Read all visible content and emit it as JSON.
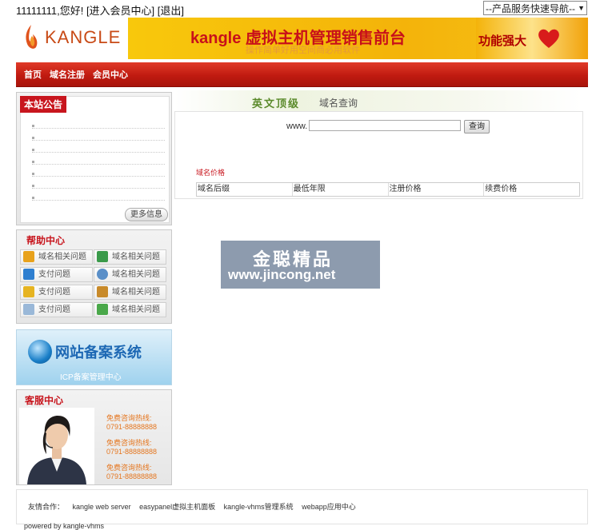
{
  "topbar": {
    "greeting": "11111111,您好!",
    "member_center": "[进入会员中心]",
    "logout": "[退出]",
    "nav_select": "--产品服务快速导航--"
  },
  "header": {
    "logo_text": "KANGLE",
    "banner_title": "kangle 虚拟主机管理销售前台",
    "banner_subtitle": "操作简单好用空间商必用软件",
    "banner_badge": "功能强大"
  },
  "nav": {
    "items": [
      "首页",
      "域名注册",
      "会员中心"
    ]
  },
  "notice": {
    "title": "本站公告",
    "more": "更多信息"
  },
  "help": {
    "title": "帮助中心",
    "items": [
      {
        "label": "域名相关问题",
        "icon": "folder-icon"
      },
      {
        "label": "域名相关问题",
        "icon": "book-icon"
      },
      {
        "label": "支付问题",
        "icon": "monitor-icon"
      },
      {
        "label": "域名相关问题",
        "icon": "eye-icon"
      },
      {
        "label": "支付问题",
        "icon": "shield-icon"
      },
      {
        "label": "域名相关问题",
        "icon": "user-icon"
      },
      {
        "label": "支付问题",
        "icon": "note-icon"
      },
      {
        "label": "域名相关问题",
        "icon": "download-icon"
      }
    ]
  },
  "beian": {
    "title": "网站备案系统",
    "subtitle": "ICP备案管理中心"
  },
  "kefu": {
    "title": "客服中心",
    "phones": [
      {
        "label": "免费咨询热线:",
        "number": "0791-88888888"
      },
      {
        "label": "免费咨询热线:",
        "number": "0791-88888888"
      },
      {
        "label": "免费咨询热线:",
        "number": "0791-88888888"
      }
    ]
  },
  "main": {
    "tab_title": "英文顶级",
    "tab_sub": "域名查询",
    "www_label": "www.",
    "domain_value": "",
    "search_button": "查询",
    "price_title": "域名价格",
    "price_columns": [
      "域名后缀",
      "最低年限",
      "注册价格",
      "续费价格"
    ]
  },
  "watermark": {
    "line1": "金聪精品",
    "line2": "www.jincong.net"
  },
  "footer": {
    "label": "友情合作：",
    "links": [
      "kangle web server",
      "easypanel虚拟主机面板",
      "kangle-vhms管理系统",
      "webapp应用中心"
    ],
    "powered": "powered by kangle-vhms"
  },
  "colors": {
    "accent_red": "#c8161e",
    "nav_red": "#c01a10",
    "banner_yellow": "#f8c80c",
    "phone_orange": "#e5761f"
  }
}
